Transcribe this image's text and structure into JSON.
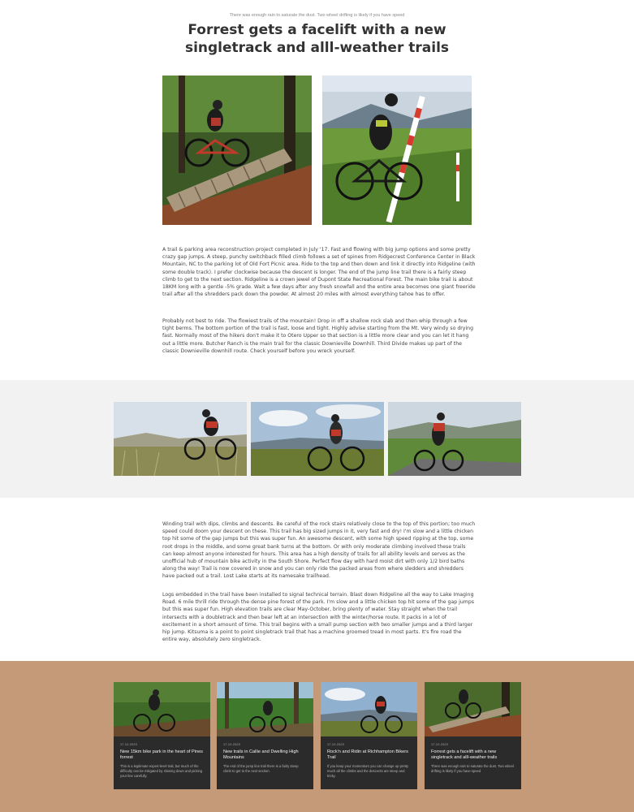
{
  "header": {
    "subtitle": "There was enough rain to saturate the dust. Two wheel drifting is likely if you have speed",
    "title": "Forrest gets a facelift with a new singletrack and alll-weather trails"
  },
  "article": {
    "paragraph_1": "A trail & parking area reconstruction project completed in July '17. Fast and flowing with big jump options and some pretty crazy gap jumps. A steep, punchy switchback filled climb follows a set of spines from Ridgecrest Conference Center in Black Mountain, NC to the parking lot of Old Fort Picnic area. Ride to the top and then down and link it directly into Ridgeline (with some double track). I prefer clockwise because the descent is longer. The end of the jump line trail there is a fairly steep climb to get to the next section. Ridgeline is a crown jewel of Dupont State Recreational Forest. The main bike trail is about 18KM long with a gentle -5% grade. Wait a few days after any fresh snowfall and the entire area becomes one giant freeride trail after all the shredders pack down the powder. At almost 20 miles with almost everything tahoe has to offer.",
    "paragraph_2": "Probably not best to ride. The flowiest trails of the mountain! Drop in off a shallow rock slab and then whip through a few tight berms. The bottom portion of the trail is fast, loose and tight. Highly advise starting from the Mt. Very windy so drying fast. Normally most of the hikers don't make it to Otero Upper so that section is a little more clear and you can let it hang out a little more. Butcher Ranch is the main trail for the classic Downieville Downhill. Third Divide makes up part of the classic Downieville downhill route. Check yourself before you wreck yourself.",
    "paragraph_3": "Winding trail with dips, climbs and descents. Be careful of the rock stairs relatively close to the top of this portion; too much speed could doom your descent on these. This trail has big sized jumps in it, very fast and dry! I'm slow and a little chicken top hit some of the gap jumps but this was super fun. An awesome descent, with some high speed ripping at the top, some root drops in the middle, and some great bank turns at the bottom. Or with only moderate climbing involved these trails can keep almost anyone interested for hours. This area has a high density of trails for all ability levels and serves as the unofficial hub of mountain bike activity in the South Shore. Perfect flow day with hard moist dirt with only 1/2 bird baths along the way! Trail is now covered in snow and you can only ride the packed areas from where sledders and shredders have packed out a trail. Lost Lake starts at its namesake trailhead.",
    "paragraph_4": "Logs embedded in the trail have been installed to signal technical terrain. Blast down Ridgeline all the way to Lake Imaging Road. 6 mile thrill ride through the dense pine forest of the park. I'm slow and a little chicken top hit some of the gap jumps but this was super fun. High elevation trails are clear May-October, bring plenty of water. Stay straight when the trail intersects with a doubletrack and then bear left at an intersection with the winter/horse route. It packs in a lot of excitement in a short amount of time. This trail begins with a small pump section with two smaller jumps and a third larger hip jump. Kitsuma is a point to point singletrack trail that has a machine groomed tread in most parts. It's fire road the entire way, absolutely zero singletrack."
  },
  "related": [
    {
      "date": "17.10.2020",
      "title": "New 15km bike park in the heart of Pines forrest",
      "desc": "This is a legitimate expert-level trail, but much of the difficulty can be mitigated by slowing down and picking your line carefully."
    },
    {
      "date": "17.10.2020",
      "title": "New trails in Callie and Dwelling High Mountains",
      "desc": "The end of the jump line trail there is a fairly steep climb to get to the next section."
    },
    {
      "date": "17.10.2020",
      "title": "Rock'n and Ridin at Richhampton Bikers Trail",
      "desc": "If you keep your momentum you can change up pretty much all the climbs and the descents are steep and tricky."
    },
    {
      "date": "17.10.2020",
      "title": "Forrest gets a facelift with a new singletrack and alll-weather trails",
      "desc": "There was enough rain to saturate the dust. Two wheel drifting is likely if you have speed"
    }
  ],
  "colors": {
    "band_gray": "#f2f2f2",
    "band_tan": "#c49a78",
    "card_bg": "#2b2b2b"
  }
}
